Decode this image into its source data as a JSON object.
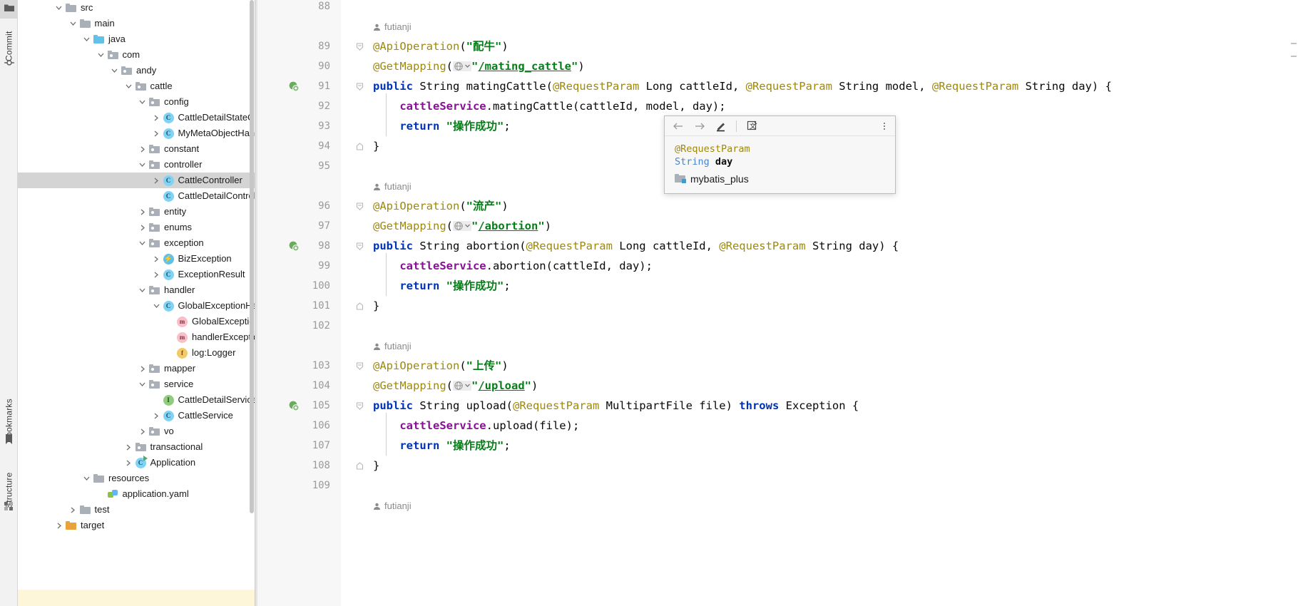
{
  "toolstrip": {
    "commit_label": "Commit",
    "bookmarks_label": "Bookmarks",
    "structure_label": "Structure"
  },
  "project_tree": {
    "items": [
      {
        "label": "src",
        "depth": 2,
        "arrow": "down",
        "icon": "folder-gray",
        "selected": false
      },
      {
        "label": "main",
        "depth": 3,
        "arrow": "down",
        "icon": "folder-gray",
        "selected": false
      },
      {
        "label": "java",
        "depth": 4,
        "arrow": "down",
        "icon": "folder-blue",
        "selected": false
      },
      {
        "label": "com",
        "depth": 5,
        "arrow": "down",
        "icon": "folder-pkg",
        "selected": false
      },
      {
        "label": "andy",
        "depth": 6,
        "arrow": "down",
        "icon": "folder-pkg",
        "selected": false
      },
      {
        "label": "cattle",
        "depth": 7,
        "arrow": "down",
        "icon": "folder-pkg",
        "selected": false
      },
      {
        "label": "config",
        "depth": 8,
        "arrow": "down",
        "icon": "folder-pkg",
        "selected": false
      },
      {
        "label": "CattleDetailStateConv",
        "depth": 9,
        "arrow": "right",
        "icon": "class",
        "selected": false
      },
      {
        "label": "MyMetaObjectHandl",
        "depth": 9,
        "arrow": "right",
        "icon": "class",
        "selected": false
      },
      {
        "label": "constant",
        "depth": 8,
        "arrow": "right",
        "icon": "folder-pkg",
        "selected": false
      },
      {
        "label": "controller",
        "depth": 8,
        "arrow": "down",
        "icon": "folder-pkg",
        "selected": false
      },
      {
        "label": "CattleController",
        "depth": 9,
        "arrow": "right",
        "icon": "class",
        "selected": true
      },
      {
        "label": "CattleDetailController",
        "depth": 9,
        "arrow": "none",
        "icon": "class",
        "selected": false
      },
      {
        "label": "entity",
        "depth": 8,
        "arrow": "right",
        "icon": "folder-pkg",
        "selected": false
      },
      {
        "label": "enums",
        "depth": 8,
        "arrow": "right",
        "icon": "folder-pkg",
        "selected": false
      },
      {
        "label": "exception",
        "depth": 8,
        "arrow": "down",
        "icon": "folder-pkg",
        "selected": false
      },
      {
        "label": "BizException",
        "depth": 9,
        "arrow": "right",
        "icon": "exception",
        "selected": false
      },
      {
        "label": "ExceptionResult",
        "depth": 9,
        "arrow": "right",
        "icon": "class",
        "selected": false
      },
      {
        "label": "handler",
        "depth": 8,
        "arrow": "down",
        "icon": "folder-pkg",
        "selected": false
      },
      {
        "label": "GlobalExceptionHand",
        "depth": 9,
        "arrow": "down",
        "icon": "class",
        "selected": false
      },
      {
        "label": "GlobalExceptionH",
        "depth": 10,
        "arrow": "none",
        "icon": "method",
        "selected": false
      },
      {
        "label": "handlerException(",
        "depth": 10,
        "arrow": "none",
        "icon": "method",
        "selected": false
      },
      {
        "label": "log:Logger",
        "depth": 10,
        "arrow": "none",
        "icon": "field",
        "selected": false
      },
      {
        "label": "mapper",
        "depth": 8,
        "arrow": "right",
        "icon": "folder-pkg",
        "selected": false
      },
      {
        "label": "service",
        "depth": 8,
        "arrow": "down",
        "icon": "folder-pkg",
        "selected": false
      },
      {
        "label": "CattleDetailService",
        "depth": 9,
        "arrow": "none",
        "icon": "interface",
        "selected": false
      },
      {
        "label": "CattleService",
        "depth": 9,
        "arrow": "right",
        "icon": "class",
        "selected": false
      },
      {
        "label": "vo",
        "depth": 8,
        "arrow": "right",
        "icon": "folder-pkg",
        "selected": false
      },
      {
        "label": "transactional",
        "depth": 7,
        "arrow": "right",
        "icon": "folder-pkg",
        "selected": false
      },
      {
        "label": "Application",
        "depth": 7,
        "arrow": "right",
        "icon": "class-run",
        "selected": false
      },
      {
        "label": "resources",
        "depth": 4,
        "arrow": "down",
        "icon": "folder-res",
        "selected": false
      },
      {
        "label": "application.yaml",
        "depth": 5,
        "arrow": "none",
        "icon": "yaml",
        "selected": false
      },
      {
        "label": "test",
        "depth": 3,
        "arrow": "right",
        "icon": "folder-gray",
        "selected": false
      },
      {
        "label": "target",
        "depth": 2,
        "arrow": "right",
        "icon": "folder-orange",
        "selected": false
      }
    ]
  },
  "editor": {
    "author_label": "futianji",
    "lines": [
      {
        "no": "88",
        "type": "blank"
      },
      {
        "no": "",
        "type": "vcs-author"
      },
      {
        "no": "89",
        "type": "code",
        "fold": "collapsed",
        "tokens": [
          {
            "t": "@ApiOperation",
            "c": "anno"
          },
          {
            "t": "(",
            "c": "punct"
          },
          {
            "t": "\"配牛\"",
            "c": "str"
          },
          {
            "t": ")",
            "c": "punct"
          }
        ]
      },
      {
        "no": "90",
        "type": "code",
        "fold": "none",
        "tokens": [
          {
            "t": "@GetMapping",
            "c": "anno"
          },
          {
            "t": "(",
            "c": "punct"
          },
          {
            "t": "GLOBE",
            "c": "globe"
          },
          {
            "t": "\"",
            "c": "str"
          },
          {
            "t": "/mating_cattle",
            "c": "link"
          },
          {
            "t": "\"",
            "c": "str"
          },
          {
            "t": ")",
            "c": "punct"
          }
        ]
      },
      {
        "no": "91",
        "type": "code",
        "fold": "expanded",
        "run": true,
        "tokens": [
          {
            "t": "public",
            "c": "kw"
          },
          {
            "t": " String matingCattle(",
            "c": "plain"
          },
          {
            "t": "@RequestParam",
            "c": "anno"
          },
          {
            "t": " Long cattleId, ",
            "c": "plain"
          },
          {
            "t": "@RequestParam",
            "c": "anno"
          },
          {
            "t": " String model, ",
            "c": "plain"
          },
          {
            "t": "@RequestParam",
            "c": "anno"
          },
          {
            "t": " String day) {",
            "c": "plain"
          }
        ]
      },
      {
        "no": "92",
        "type": "code",
        "fold": "none",
        "indent": true,
        "tokens": [
          {
            "t": "    ",
            "c": "plain"
          },
          {
            "t": "cattleService",
            "c": "field"
          },
          {
            "t": ".matingCattle(cattleId, model, day);",
            "c": "plain"
          }
        ]
      },
      {
        "no": "93",
        "type": "code",
        "fold": "none",
        "indent": true,
        "tokens": [
          {
            "t": "    ",
            "c": "plain"
          },
          {
            "t": "return",
            "c": "kw"
          },
          {
            "t": " ",
            "c": "plain"
          },
          {
            "t": "\"操作成功\"",
            "c": "str"
          },
          {
            "t": ";",
            "c": "punct"
          }
        ]
      },
      {
        "no": "94",
        "type": "code",
        "fold": "end",
        "tokens": [
          {
            "t": "}",
            "c": "plain"
          }
        ]
      },
      {
        "no": "95",
        "type": "blank"
      },
      {
        "no": "",
        "type": "vcs-author"
      },
      {
        "no": "96",
        "type": "code",
        "fold": "collapsed",
        "tokens": [
          {
            "t": "@ApiOperation",
            "c": "anno"
          },
          {
            "t": "(",
            "c": "punct"
          },
          {
            "t": "\"流产\"",
            "c": "str"
          },
          {
            "t": ")",
            "c": "punct"
          }
        ]
      },
      {
        "no": "97",
        "type": "code",
        "fold": "none",
        "tokens": [
          {
            "t": "@GetMapping",
            "c": "anno"
          },
          {
            "t": "(",
            "c": "punct"
          },
          {
            "t": "GLOBE",
            "c": "globe"
          },
          {
            "t": "\"",
            "c": "str"
          },
          {
            "t": "/abortion",
            "c": "link"
          },
          {
            "t": "\"",
            "c": "str"
          },
          {
            "t": ")",
            "c": "punct"
          }
        ]
      },
      {
        "no": "98",
        "type": "code",
        "fold": "expanded",
        "run": true,
        "tokens": [
          {
            "t": "public",
            "c": "kw"
          },
          {
            "t": " String abortion(",
            "c": "plain"
          },
          {
            "t": "@RequestParam",
            "c": "anno"
          },
          {
            "t": " Long cattleId, ",
            "c": "plain"
          },
          {
            "t": "@RequestParam",
            "c": "anno"
          },
          {
            "t": " String day) {",
            "c": "plain"
          }
        ]
      },
      {
        "no": "99",
        "type": "code",
        "fold": "none",
        "indent": true,
        "tokens": [
          {
            "t": "    ",
            "c": "plain"
          },
          {
            "t": "cattleService",
            "c": "field"
          },
          {
            "t": ".abortion(cattleId, day);",
            "c": "plain"
          }
        ]
      },
      {
        "no": "100",
        "type": "code",
        "fold": "none",
        "indent": true,
        "tokens": [
          {
            "t": "    ",
            "c": "plain"
          },
          {
            "t": "return",
            "c": "kw"
          },
          {
            "t": " ",
            "c": "plain"
          },
          {
            "t": "\"操作成功\"",
            "c": "str"
          },
          {
            "t": ";",
            "c": "punct"
          }
        ]
      },
      {
        "no": "101",
        "type": "code",
        "fold": "end",
        "tokens": [
          {
            "t": "}",
            "c": "plain"
          }
        ]
      },
      {
        "no": "102",
        "type": "blank"
      },
      {
        "no": "",
        "type": "vcs-author"
      },
      {
        "no": "103",
        "type": "code",
        "fold": "collapsed",
        "tokens": [
          {
            "t": "@ApiOperation",
            "c": "anno"
          },
          {
            "t": "(",
            "c": "punct"
          },
          {
            "t": "\"上传\"",
            "c": "str"
          },
          {
            "t": ")",
            "c": "punct"
          }
        ]
      },
      {
        "no": "104",
        "type": "code",
        "fold": "none",
        "tokens": [
          {
            "t": "@GetMapping",
            "c": "anno"
          },
          {
            "t": "(",
            "c": "punct"
          },
          {
            "t": "GLOBE",
            "c": "globe"
          },
          {
            "t": "\"",
            "c": "str"
          },
          {
            "t": "/upload",
            "c": "link"
          },
          {
            "t": "\"",
            "c": "str"
          },
          {
            "t": ")",
            "c": "punct"
          }
        ]
      },
      {
        "no": "105",
        "type": "code",
        "fold": "expanded",
        "run": true,
        "tokens": [
          {
            "t": "public",
            "c": "kw"
          },
          {
            "t": " String upload(",
            "c": "plain"
          },
          {
            "t": "@RequestParam",
            "c": "anno"
          },
          {
            "t": " MultipartFile file) ",
            "c": "plain"
          },
          {
            "t": "throws",
            "c": "kw"
          },
          {
            "t": " Exception {",
            "c": "plain"
          }
        ]
      },
      {
        "no": "106",
        "type": "code",
        "fold": "none",
        "indent": true,
        "tokens": [
          {
            "t": "    ",
            "c": "plain"
          },
          {
            "t": "cattleService",
            "c": "field"
          },
          {
            "t": ".upload(file);",
            "c": "plain"
          }
        ]
      },
      {
        "no": "107",
        "type": "code",
        "fold": "none",
        "indent": true,
        "tokens": [
          {
            "t": "    ",
            "c": "plain"
          },
          {
            "t": "return",
            "c": "kw"
          },
          {
            "t": " ",
            "c": "plain"
          },
          {
            "t": "\"操作成功\"",
            "c": "str"
          },
          {
            "t": ";",
            "c": "punct"
          }
        ]
      },
      {
        "no": "108",
        "type": "code",
        "fold": "end",
        "tokens": [
          {
            "t": "}",
            "c": "plain"
          }
        ]
      },
      {
        "no": "109",
        "type": "blank"
      },
      {
        "no": "",
        "type": "vcs-author"
      }
    ]
  },
  "doc_popup": {
    "back_icon": "arrow-left-icon",
    "forward_icon": "arrow-right-icon",
    "edit_icon": "pencil-icon",
    "translate_icon": "translate-icon",
    "menu_icon": "kebab-menu-icon",
    "annotation": "@RequestParam",
    "type": "String",
    "name": "day",
    "module": "mybatis_plus"
  },
  "colors": {
    "selection": "#d4d4d4",
    "keyword": "#0033b3",
    "string": "#067d17",
    "annotation": "#9e880d",
    "field": "#871094",
    "gutter_bg": "#f7f7f7",
    "linenum": "#9a9a9a"
  }
}
